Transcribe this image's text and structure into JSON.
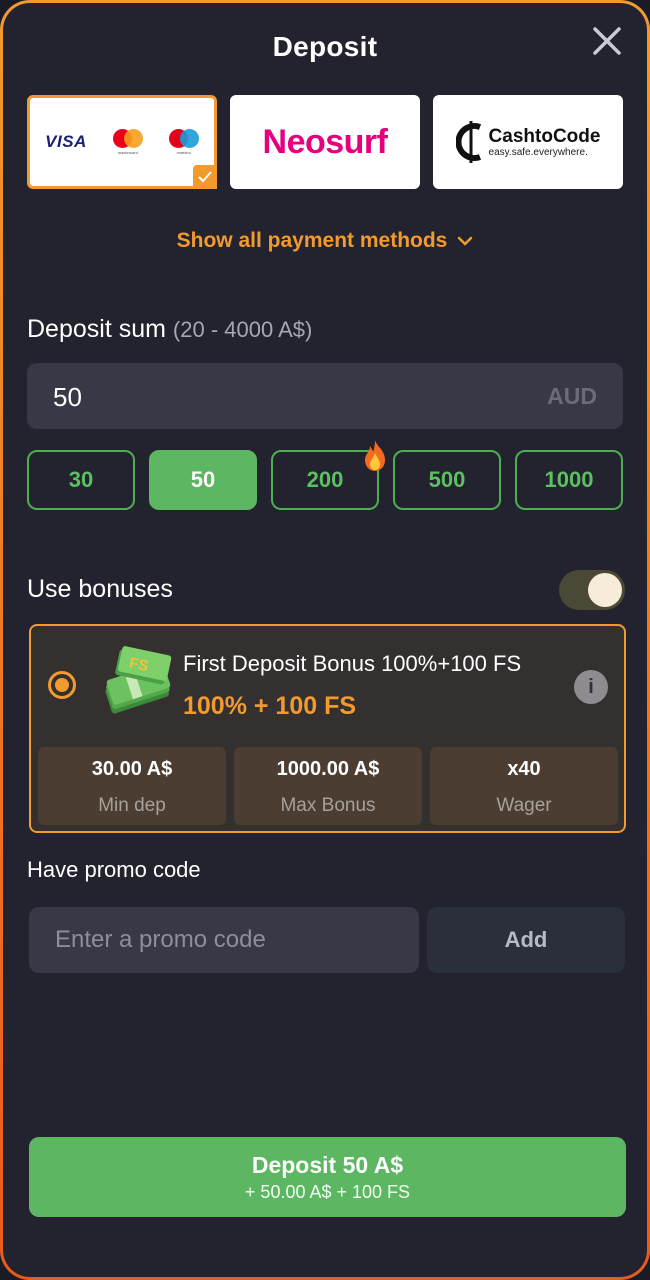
{
  "title": "Deposit",
  "payment_methods": [
    {
      "name": "Visa / Mastercard / Maestro",
      "visa": "VISA",
      "mastercard_sub": "mastercard",
      "maestro_sub": "maestro",
      "selected": true
    },
    {
      "name": "Neosurf",
      "logo_text": "Neosurf"
    },
    {
      "name": "CashtoCode",
      "logo_main": "CashtoCode",
      "logo_sub": "easy.safe.everywhere."
    }
  ],
  "show_all_label": "Show all payment methods",
  "deposit_sum": {
    "label": "Deposit sum",
    "range": "(20 - 4000 A$)"
  },
  "amount": {
    "value": "50",
    "currency": "AUD"
  },
  "quick_amounts": [
    {
      "label": "30"
    },
    {
      "label": "50",
      "active": true
    },
    {
      "label": "200",
      "hot": true
    },
    {
      "label": "500"
    },
    {
      "label": "1000"
    }
  ],
  "bonuses": {
    "label": "Use bonuses",
    "enabled": true,
    "card": {
      "title": "First Deposit Bonus 100%+100 FS",
      "value": "100% + 100 FS",
      "stats": [
        {
          "value": "30.00 A$",
          "label": "Min dep"
        },
        {
          "value": "1000.00 A$",
          "label": "Max Bonus"
        },
        {
          "value": "x40",
          "label": "Wager"
        }
      ]
    }
  },
  "promo": {
    "label": "Have promo code",
    "placeholder": "Enter a promo code",
    "add_label": "Add"
  },
  "deposit_button": {
    "main": "Deposit 50 A$",
    "sub": "+ 50.00 A$ + 100 FS"
  },
  "colors": {
    "accent": "#f29a2e",
    "green": "#5cb662",
    "panel": "#22232e"
  }
}
